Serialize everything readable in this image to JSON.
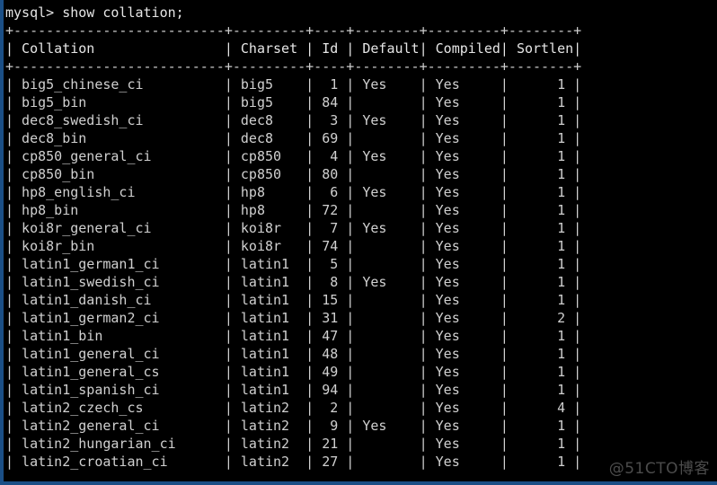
{
  "window": {
    "frame_color": "#1b4f86",
    "background_color": "#000000",
    "text_color": "#d8d8d8"
  },
  "prompt": {
    "prefix": "mysql>",
    "command": "show collation;",
    "full_line": "mysql> show collation;"
  },
  "watermark": {
    "text": "@51CTO博客",
    "color": "#5a5a5a"
  },
  "table": {
    "columns": [
      {
        "label": "Collation",
        "width": 26,
        "align": "left"
      },
      {
        "label": "Charset",
        "width": 9,
        "align": "left"
      },
      {
        "label": "Id",
        "width": 4,
        "align": "right"
      },
      {
        "label": "Default",
        "width": 8,
        "align": "left"
      },
      {
        "label": "Compiled",
        "width": 9,
        "align": "left"
      },
      {
        "label": "Sortlen",
        "width": 8,
        "align": "right"
      }
    ],
    "rows": [
      {
        "collation": "big5_chinese_ci",
        "charset": "big5",
        "id": "1",
        "default": "Yes",
        "compiled": "Yes",
        "sortlen": "1"
      },
      {
        "collation": "big5_bin",
        "charset": "big5",
        "id": "84",
        "default": "",
        "compiled": "Yes",
        "sortlen": "1"
      },
      {
        "collation": "dec8_swedish_ci",
        "charset": "dec8",
        "id": "3",
        "default": "Yes",
        "compiled": "Yes",
        "sortlen": "1"
      },
      {
        "collation": "dec8_bin",
        "charset": "dec8",
        "id": "69",
        "default": "",
        "compiled": "Yes",
        "sortlen": "1"
      },
      {
        "collation": "cp850_general_ci",
        "charset": "cp850",
        "id": "4",
        "default": "Yes",
        "compiled": "Yes",
        "sortlen": "1"
      },
      {
        "collation": "cp850_bin",
        "charset": "cp850",
        "id": "80",
        "default": "",
        "compiled": "Yes",
        "sortlen": "1"
      },
      {
        "collation": "hp8_english_ci",
        "charset": "hp8",
        "id": "6",
        "default": "Yes",
        "compiled": "Yes",
        "sortlen": "1"
      },
      {
        "collation": "hp8_bin",
        "charset": "hp8",
        "id": "72",
        "default": "",
        "compiled": "Yes",
        "sortlen": "1"
      },
      {
        "collation": "koi8r_general_ci",
        "charset": "koi8r",
        "id": "7",
        "default": "Yes",
        "compiled": "Yes",
        "sortlen": "1"
      },
      {
        "collation": "koi8r_bin",
        "charset": "koi8r",
        "id": "74",
        "default": "",
        "compiled": "Yes",
        "sortlen": "1"
      },
      {
        "collation": "latin1_german1_ci",
        "charset": "latin1",
        "id": "5",
        "default": "",
        "compiled": "Yes",
        "sortlen": "1"
      },
      {
        "collation": "latin1_swedish_ci",
        "charset": "latin1",
        "id": "8",
        "default": "Yes",
        "compiled": "Yes",
        "sortlen": "1"
      },
      {
        "collation": "latin1_danish_ci",
        "charset": "latin1",
        "id": "15",
        "default": "",
        "compiled": "Yes",
        "sortlen": "1"
      },
      {
        "collation": "latin1_german2_ci",
        "charset": "latin1",
        "id": "31",
        "default": "",
        "compiled": "Yes",
        "sortlen": "2"
      },
      {
        "collation": "latin1_bin",
        "charset": "latin1",
        "id": "47",
        "default": "",
        "compiled": "Yes",
        "sortlen": "1"
      },
      {
        "collation": "latin1_general_ci",
        "charset": "latin1",
        "id": "48",
        "default": "",
        "compiled": "Yes",
        "sortlen": "1"
      },
      {
        "collation": "latin1_general_cs",
        "charset": "latin1",
        "id": "49",
        "default": "",
        "compiled": "Yes",
        "sortlen": "1"
      },
      {
        "collation": "latin1_spanish_ci",
        "charset": "latin1",
        "id": "94",
        "default": "",
        "compiled": "Yes",
        "sortlen": "1"
      },
      {
        "collation": "latin2_czech_cs",
        "charset": "latin2",
        "id": "2",
        "default": "",
        "compiled": "Yes",
        "sortlen": "4"
      },
      {
        "collation": "latin2_general_ci",
        "charset": "latin2",
        "id": "9",
        "default": "Yes",
        "compiled": "Yes",
        "sortlen": "1"
      },
      {
        "collation": "latin2_hungarian_ci",
        "charset": "latin2",
        "id": "21",
        "default": "",
        "compiled": "Yes",
        "sortlen": "1"
      },
      {
        "collation": "latin2_croatian_ci",
        "charset": "latin2",
        "id": "27",
        "default": "",
        "compiled": "Yes",
        "sortlen": "1"
      }
    ]
  }
}
